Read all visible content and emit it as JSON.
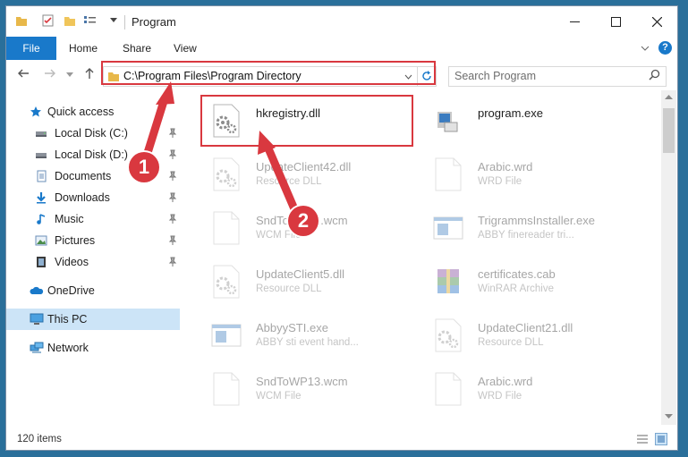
{
  "window": {
    "title": "Program"
  },
  "ribbon": {
    "tabs": [
      "File",
      "Home",
      "Share",
      "View"
    ],
    "help": "?"
  },
  "nav": {
    "address": "C:\\Program Files\\Program Directory",
    "search_placeholder": "Search Program"
  },
  "sidebar": {
    "items": [
      {
        "label": "Quick access",
        "icon": "star-icon",
        "pinned": false
      },
      {
        "label": "Local Disk (C:)",
        "icon": "drive-icon",
        "pinned": true
      },
      {
        "label": "Local Disk (D:)",
        "icon": "drive-icon",
        "pinned": true
      },
      {
        "label": "Documents",
        "icon": "documents-icon",
        "pinned": true
      },
      {
        "label": "Downloads",
        "icon": "downloads-icon",
        "pinned": true
      },
      {
        "label": "Music",
        "icon": "music-icon",
        "pinned": true
      },
      {
        "label": "Pictures",
        "icon": "pictures-icon",
        "pinned": true
      },
      {
        "label": "Videos",
        "icon": "videos-icon",
        "pinned": true
      },
      {
        "label": "OneDrive",
        "icon": "onedrive-icon",
        "pinned": false
      },
      {
        "label": "This PC",
        "icon": "pc-icon",
        "pinned": false,
        "selected": true
      },
      {
        "label": "Network",
        "icon": "network-icon",
        "pinned": false
      }
    ]
  },
  "files": [
    {
      "name": "hkregistry.dll",
      "type": "",
      "icon": "gear-file-icon",
      "highlighted": true
    },
    {
      "name": "program.exe",
      "type": "",
      "icon": "exe-icon"
    },
    {
      "name": "UpdateClient42.dll",
      "type": "Resource DLL",
      "icon": "gear-file-icon"
    },
    {
      "name": "Arabic.wrd",
      "type": "WRD File",
      "icon": "blank-file-icon"
    },
    {
      "name": "SndToWP13.wcm",
      "type": "WCM File",
      "icon": "blank-file-icon"
    },
    {
      "name": "TrigrammsInstaller.exe",
      "type": "ABBY finereader tri...",
      "icon": "window-file-icon"
    },
    {
      "name": "UpdateClient5.dll",
      "type": "Resource DLL",
      "icon": "gear-file-icon"
    },
    {
      "name": "certificates.cab",
      "type": "WinRAR Archive",
      "icon": "winrar-icon"
    },
    {
      "name": "AbbyySTI.exe",
      "type": "ABBY sti event hand...",
      "icon": "window-file-icon"
    },
    {
      "name": "UpdateClient21.dll",
      "type": "Resource DLL",
      "icon": "gear-file-icon"
    },
    {
      "name": "SndToWP13.wcm",
      "type": "WCM File",
      "icon": "blank-file-icon"
    },
    {
      "name": "Arabic.wrd",
      "type": "WRD File",
      "icon": "blank-file-icon"
    }
  ],
  "status": {
    "count": "120 items"
  },
  "callouts": [
    "1",
    "2"
  ],
  "colors": {
    "accent": "#1979ca",
    "highlight": "#d9383f",
    "selected": "#cce4f7"
  }
}
